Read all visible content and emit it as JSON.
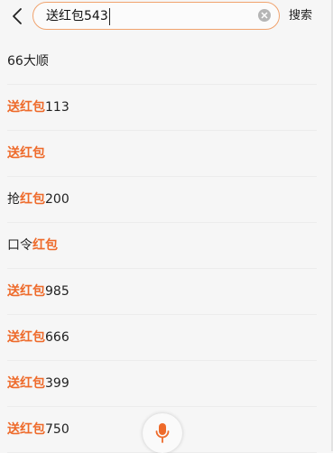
{
  "search": {
    "query": "送红包543"
  },
  "header": {
    "search_button_label": "搜索"
  },
  "suggestions": [
    {
      "segments": [
        {
          "text": "66大顺",
          "highlight": false
        }
      ]
    },
    {
      "segments": [
        {
          "text": "送红包",
          "highlight": true
        },
        {
          "text": "113",
          "highlight": false
        }
      ]
    },
    {
      "segments": [
        {
          "text": "送红包",
          "highlight": true
        }
      ]
    },
    {
      "segments": [
        {
          "text": "抢",
          "highlight": false
        },
        {
          "text": "红包",
          "highlight": true
        },
        {
          "text": "200",
          "highlight": false
        }
      ]
    },
    {
      "segments": [
        {
          "text": "口令",
          "highlight": false
        },
        {
          "text": "红包",
          "highlight": true
        }
      ]
    },
    {
      "segments": [
        {
          "text": "送红包",
          "highlight": true
        },
        {
          "text": "985",
          "highlight": false
        }
      ]
    },
    {
      "segments": [
        {
          "text": "送红包",
          "highlight": true
        },
        {
          "text": "666",
          "highlight": false
        }
      ]
    },
    {
      "segments": [
        {
          "text": "送红包",
          "highlight": true
        },
        {
          "text": "399",
          "highlight": false
        }
      ]
    },
    {
      "segments": [
        {
          "text": "送红包",
          "highlight": true
        },
        {
          "text": "750",
          "highlight": false
        }
      ]
    }
  ],
  "colors": {
    "accent": "#ee6a2a",
    "search_border": "#f0a36e",
    "background": "#f6f6f6"
  },
  "icons": {
    "back": "chevron-left-icon",
    "clear": "clear-circle-icon",
    "voice": "microphone-icon"
  }
}
